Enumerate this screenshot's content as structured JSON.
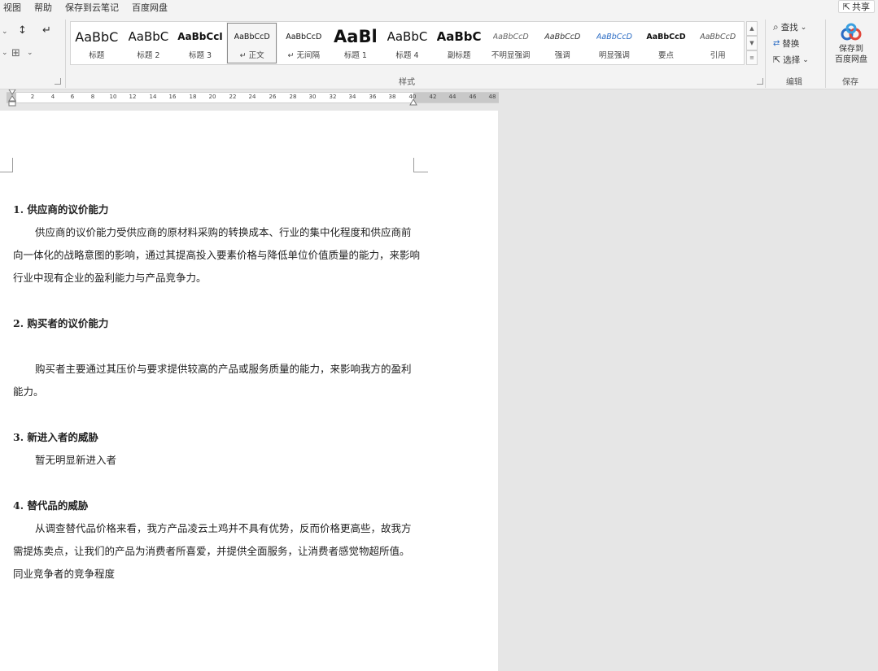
{
  "menu": {
    "items": [
      "视图",
      "帮助",
      "保存到云笔记",
      "百度网盘"
    ],
    "share": "共享"
  },
  "ribbon": {
    "styles_group_label": "样式",
    "edit_group_label": "编辑",
    "save_group_label": "保存",
    "styles": [
      {
        "sample": "AaBbC",
        "name": "标题"
      },
      {
        "sample": "AaBbC",
        "name": "标题 2"
      },
      {
        "sample": "AaBbCcI",
        "name": "标题 3"
      },
      {
        "sample": "AaBbCcD",
        "name": "↵ 正文"
      },
      {
        "sample": "AaBbCcD",
        "name": "↵ 无间隔"
      },
      {
        "sample": "AaBl",
        "name": "标题 1"
      },
      {
        "sample": "AaBbC",
        "name": "标题 4"
      },
      {
        "sample": "AaBbC",
        "name": "副标题"
      },
      {
        "sample": "AaBbCcD",
        "name": "不明显强调"
      },
      {
        "sample": "AaBbCcD",
        "name": "强调"
      },
      {
        "sample": "AaBbCcD",
        "name": "明显强调"
      },
      {
        "sample": "AaBbCcD",
        "name": "要点"
      },
      {
        "sample": "AaBbCcD",
        "name": "引用"
      }
    ],
    "selected_style": "↵ 正文",
    "find": "查找",
    "replace": "替换",
    "select": "选择",
    "save_label": "保存到\n百度网盘"
  },
  "ruler": {
    "ticks": [
      "2",
      "4",
      "6",
      "8",
      "10",
      "12",
      "14",
      "16",
      "18",
      "20",
      "22",
      "24",
      "26",
      "28",
      "30",
      "32",
      "34",
      "36",
      "38",
      "40",
      "42",
      "44",
      "46",
      "48"
    ]
  },
  "document": {
    "h1": "1. 供应商的议价能力",
    "p1": "供应商的议价能力受供应商的原材料采购的转换成本、行业的集中化程度和供应商前向一体化的战略意图的影响，通过其提高投入要素价格与降低单位价值质量的能力，来影响行业中现有企业的盈利能力与产品竞争力。",
    "h2": "2. 购买者的议价能力",
    "p2": "购买者主要通过其压价与要求提供较高的产品或服务质量的能力，来影响我方的盈利能力。",
    "h3": "3. 新进入者的威胁",
    "p3": "暂无明显新进入者",
    "h4": "4. 替代品的威胁",
    "p4": "从调查替代品价格来看，我方产品凌云土鸡并不具有优势，反而价格更高些，故我方需提炼卖点，让我们的产品为消费者所喜爱，并提供全面服务，让消费者感觉物超所值。",
    "p5": "同业竞争者的竞争程度"
  },
  "colors": {
    "ribbon_bg": "#f3f3f3",
    "workspace_bg": "#e6e6e6",
    "accent_blue": "#2b6cc4"
  }
}
